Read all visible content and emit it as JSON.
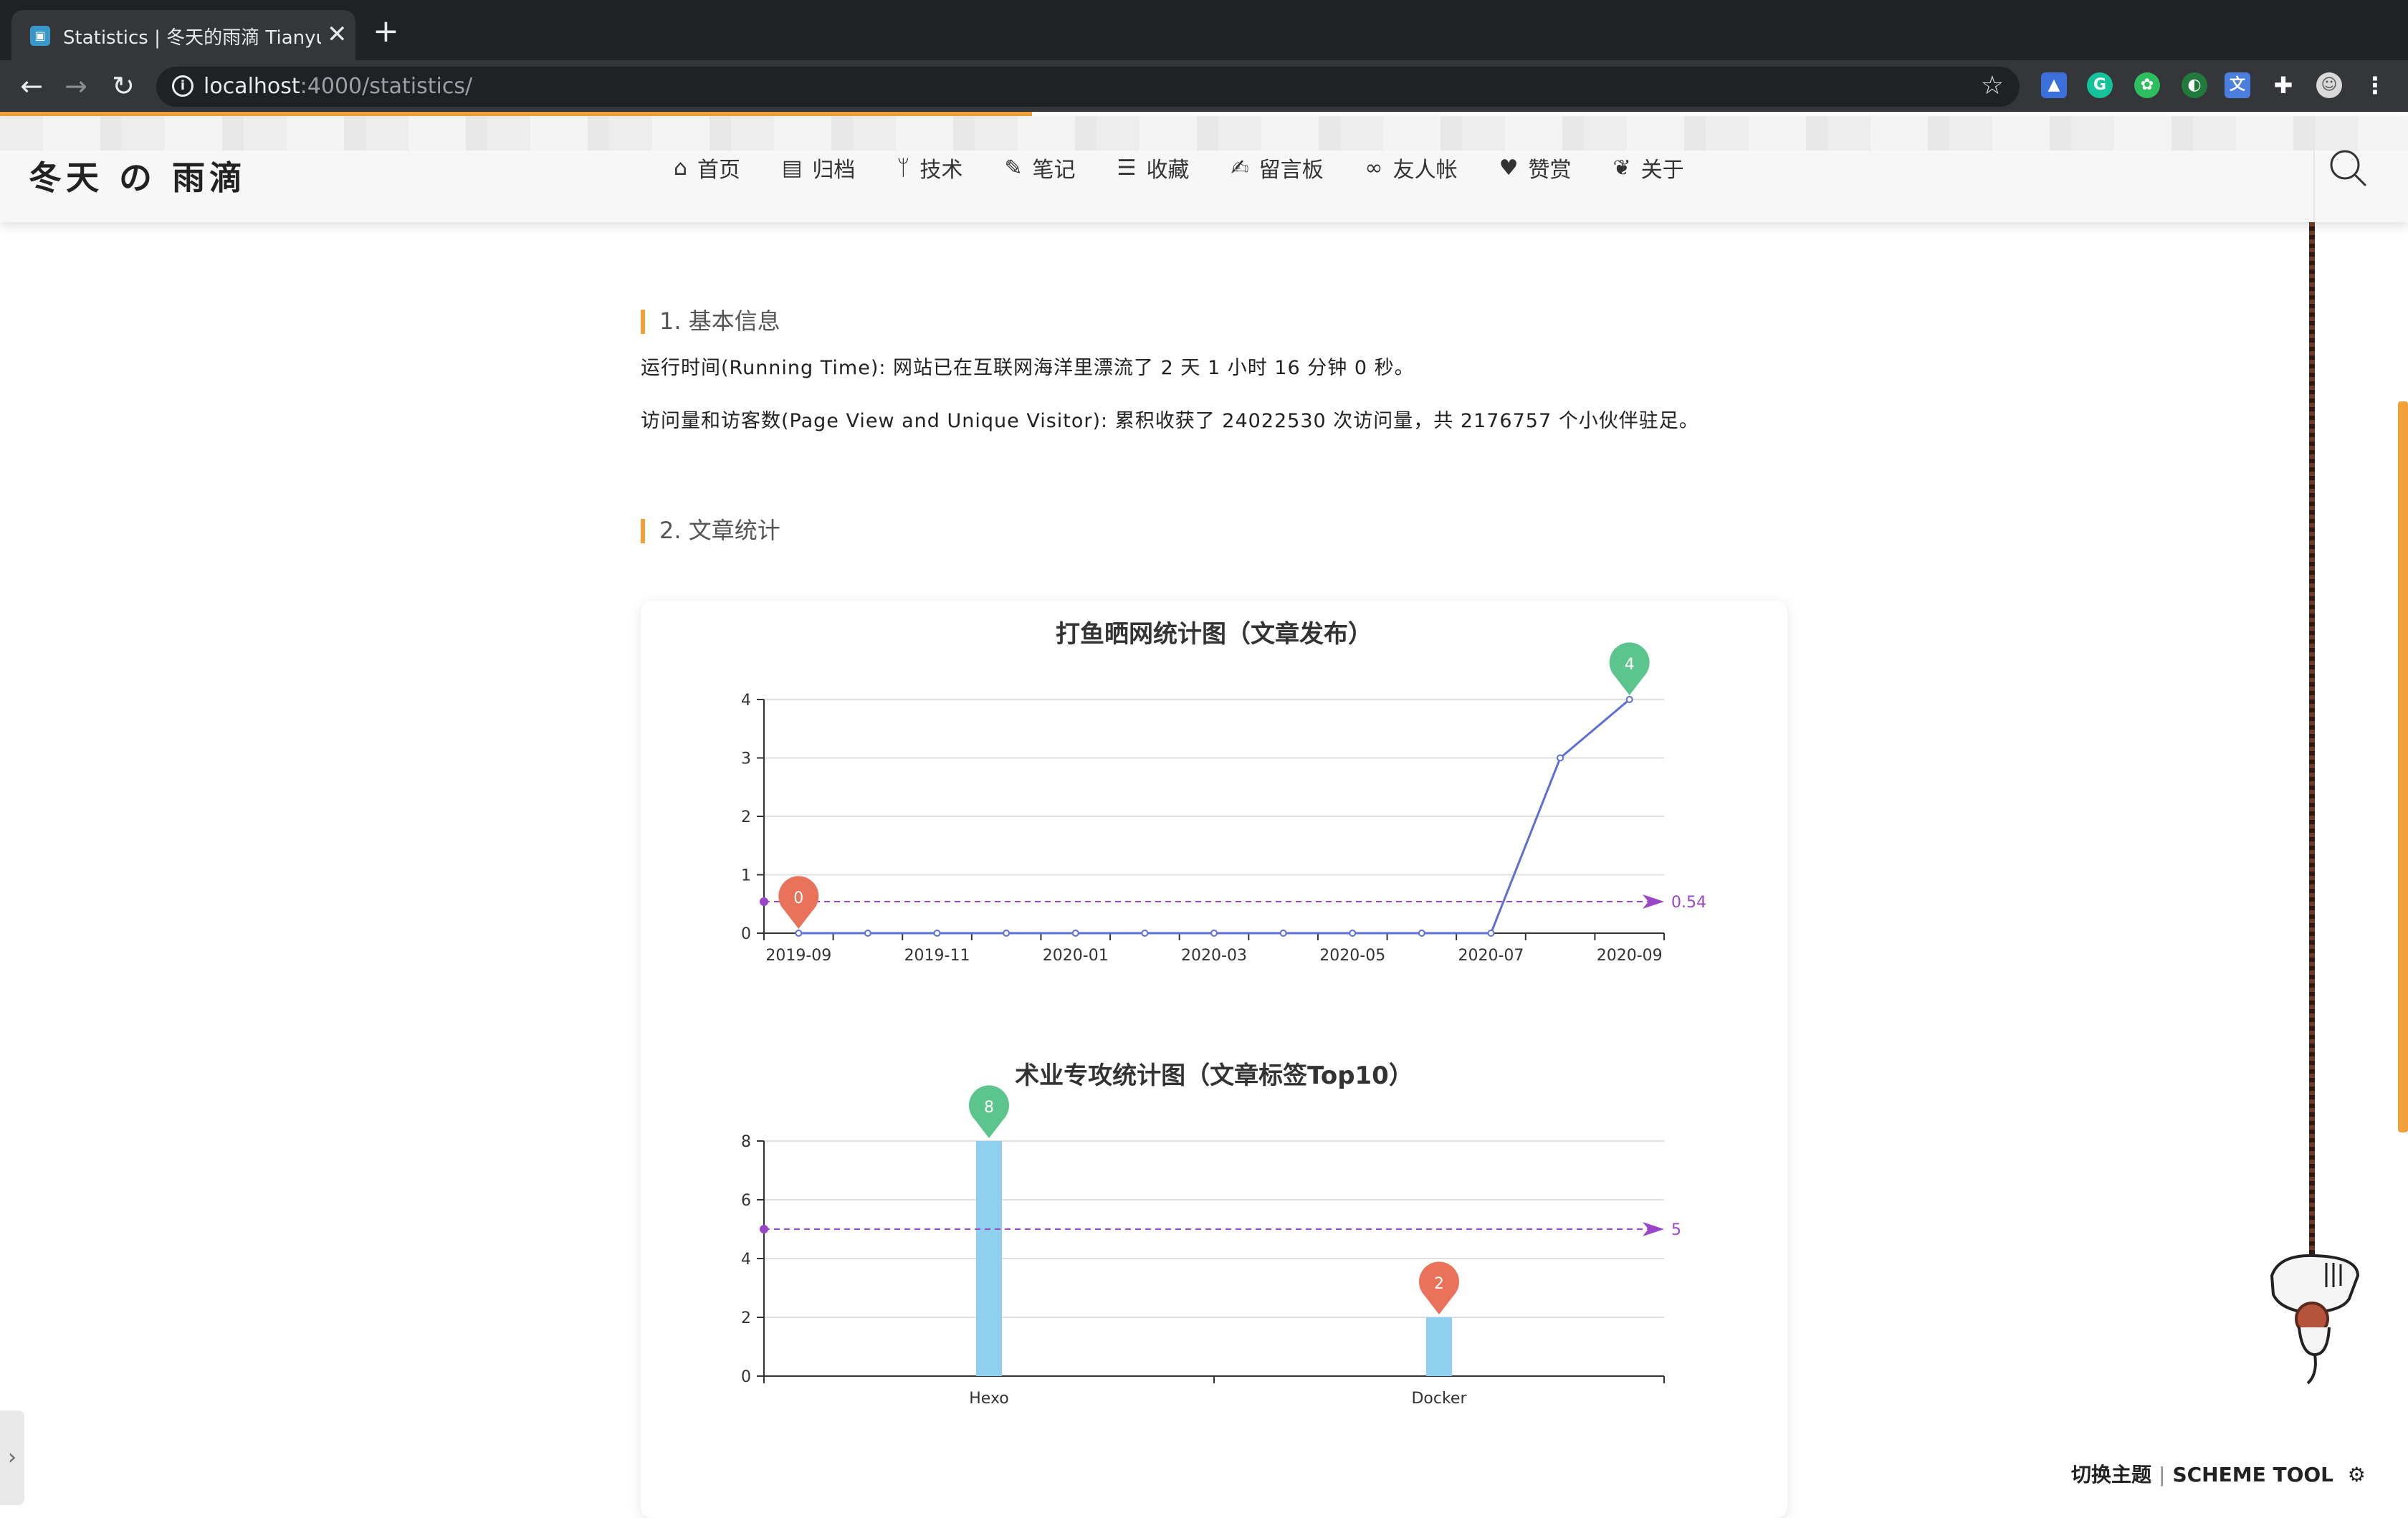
{
  "browser": {
    "tab_title": "Statistics | 冬天的雨滴 Tianyu C",
    "tab_close": "✕",
    "new_tab": "+",
    "url_host": "localhost",
    "url_rest": ":4000/statistics/"
  },
  "site": {
    "logo": "冬天 の 雨滴",
    "menu": [
      {
        "icon": "⌂",
        "label": "首页"
      },
      {
        "icon": "▤",
        "label": "归档"
      },
      {
        "icon": "ᛘ",
        "label": "技术"
      },
      {
        "icon": "✎",
        "label": "笔记"
      },
      {
        "icon": "☰",
        "label": "收藏"
      },
      {
        "icon": "✍",
        "label": "留言板"
      },
      {
        "icon": "∞",
        "label": "友人帐"
      },
      {
        "icon": "♥",
        "label": "赞赏"
      },
      {
        "icon": "❦",
        "label": "关于"
      }
    ]
  },
  "content": {
    "section1_title": "1. 基本信息",
    "running_time": "运行时间(Running Time): 网站已在互联网海洋里漂流了 2 天 1 小时 16 分钟 0 秒。",
    "visits": "访问量和访客数(Page View and Unique Visitor): 累积收获了 24022530 次访问量，共 2176757 个小伙伴驻足。",
    "section2_title": "2. 文章统计"
  },
  "chart_data": [
    {
      "type": "line",
      "title": "打鱼晒网统计图（文章发布）",
      "x": [
        "2019-09",
        "2019-10",
        "2019-11",
        "2019-12",
        "2020-01",
        "2020-02",
        "2020-03",
        "2020-04",
        "2020-05",
        "2020-06",
        "2020-07",
        "2020-08",
        "2020-09"
      ],
      "x_tick_labels": [
        "2019-09",
        "2019-11",
        "2020-01",
        "2020-03",
        "2020-05",
        "2020-07",
        "2020-09"
      ],
      "values": [
        0,
        0,
        0,
        0,
        0,
        0,
        0,
        0,
        0,
        0,
        0,
        3,
        4
      ],
      "ylim": [
        0,
        4
      ],
      "yticks": [
        0,
        1,
        2,
        3,
        4
      ],
      "mark_max": {
        "label": "4",
        "index": 12
      },
      "mark_min": {
        "label": "0",
        "index": 0
      },
      "average": {
        "value": 0.54,
        "label": "0.54"
      },
      "line_color": "#5b6fd6"
    },
    {
      "type": "bar",
      "title": "术业专攻统计图（文章标签Top10）",
      "categories": [
        "Hexo",
        "Docker"
      ],
      "values": [
        8,
        2
      ],
      "ylim": [
        0,
        8
      ],
      "yticks": [
        0,
        2,
        4,
        6,
        8
      ],
      "mark_max": {
        "label": "8",
        "index": 0
      },
      "mark_min": {
        "label": "2",
        "index": 1
      },
      "average": {
        "value": 5,
        "label": "5"
      },
      "bar_color": "#8fd0ef"
    }
  ],
  "scheme_tool": {
    "left": "切换主题",
    "sep": "|",
    "right": "SCHEME TOOL"
  },
  "colors": {
    "accent": "#f0a13a",
    "max_pin": "#5cc58e",
    "min_pin": "#e8735a",
    "avg_line": "#9b45c9"
  }
}
